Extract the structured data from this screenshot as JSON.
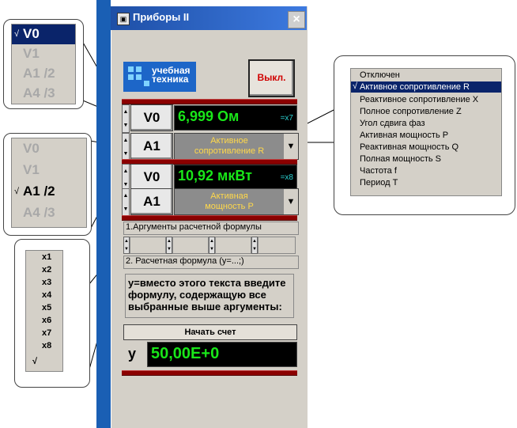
{
  "window": {
    "title": "Приборы  II",
    "close_glyph": "×"
  },
  "logo": {
    "text_line1": "учебная",
    "text_line2": "техника"
  },
  "off_button": {
    "label": "Выкл."
  },
  "channel1": {
    "source": "V0",
    "value": "6,999 Ом",
    "multiplier": "=x7",
    "selector": "A1",
    "mode_line1": "Активное",
    "mode_line2": "сопротивление  R"
  },
  "channel2": {
    "source": "V0",
    "value": "10,92 мкВт",
    "multiplier": "=x8",
    "selector": "A1",
    "mode_line1": "Активная",
    "mode_line2": "мощность  P"
  },
  "formula_section": {
    "args_label": "1.Аргументы расчетной формулы",
    "formula_label": "2. Расчетная формула (y=...;)",
    "formula_text": "у=вместо этого текста введите формулу, содержащую все выбранные выше аргументы:",
    "start_button": "Начать счет",
    "result_label": "y",
    "result_value": "50,00E+0"
  },
  "popup_v": {
    "items": [
      "V0",
      "V1",
      "A1  /2",
      "A4  /3"
    ],
    "check": "√"
  },
  "popup_a": {
    "items": [
      "V0",
      "V1",
      "A1  /2",
      "A4  /3"
    ],
    "check": "√"
  },
  "popup_x": {
    "items": [
      "x1",
      "x2",
      "x3",
      "x4",
      "x5",
      "x6",
      "x7",
      "x8"
    ],
    "check": "√"
  },
  "popup_modes": {
    "items": [
      "Отключен",
      "Активное сопротивление  R",
      "Реактивное сопротивление  X",
      "Полное сопротивление  Z",
      "Угол сдвига фаз",
      "Активная мощность  P",
      "Реактивная мощность  Q",
      "Полная мощность  S",
      "Частота  f",
      "Период  T"
    ],
    "check": "√"
  },
  "colors": {
    "lcd_green": "#19e619",
    "mode_text": "#ffd84a",
    "separator": "#8b0000",
    "highlight": "#0a246a",
    "off_text": "#d00000"
  }
}
